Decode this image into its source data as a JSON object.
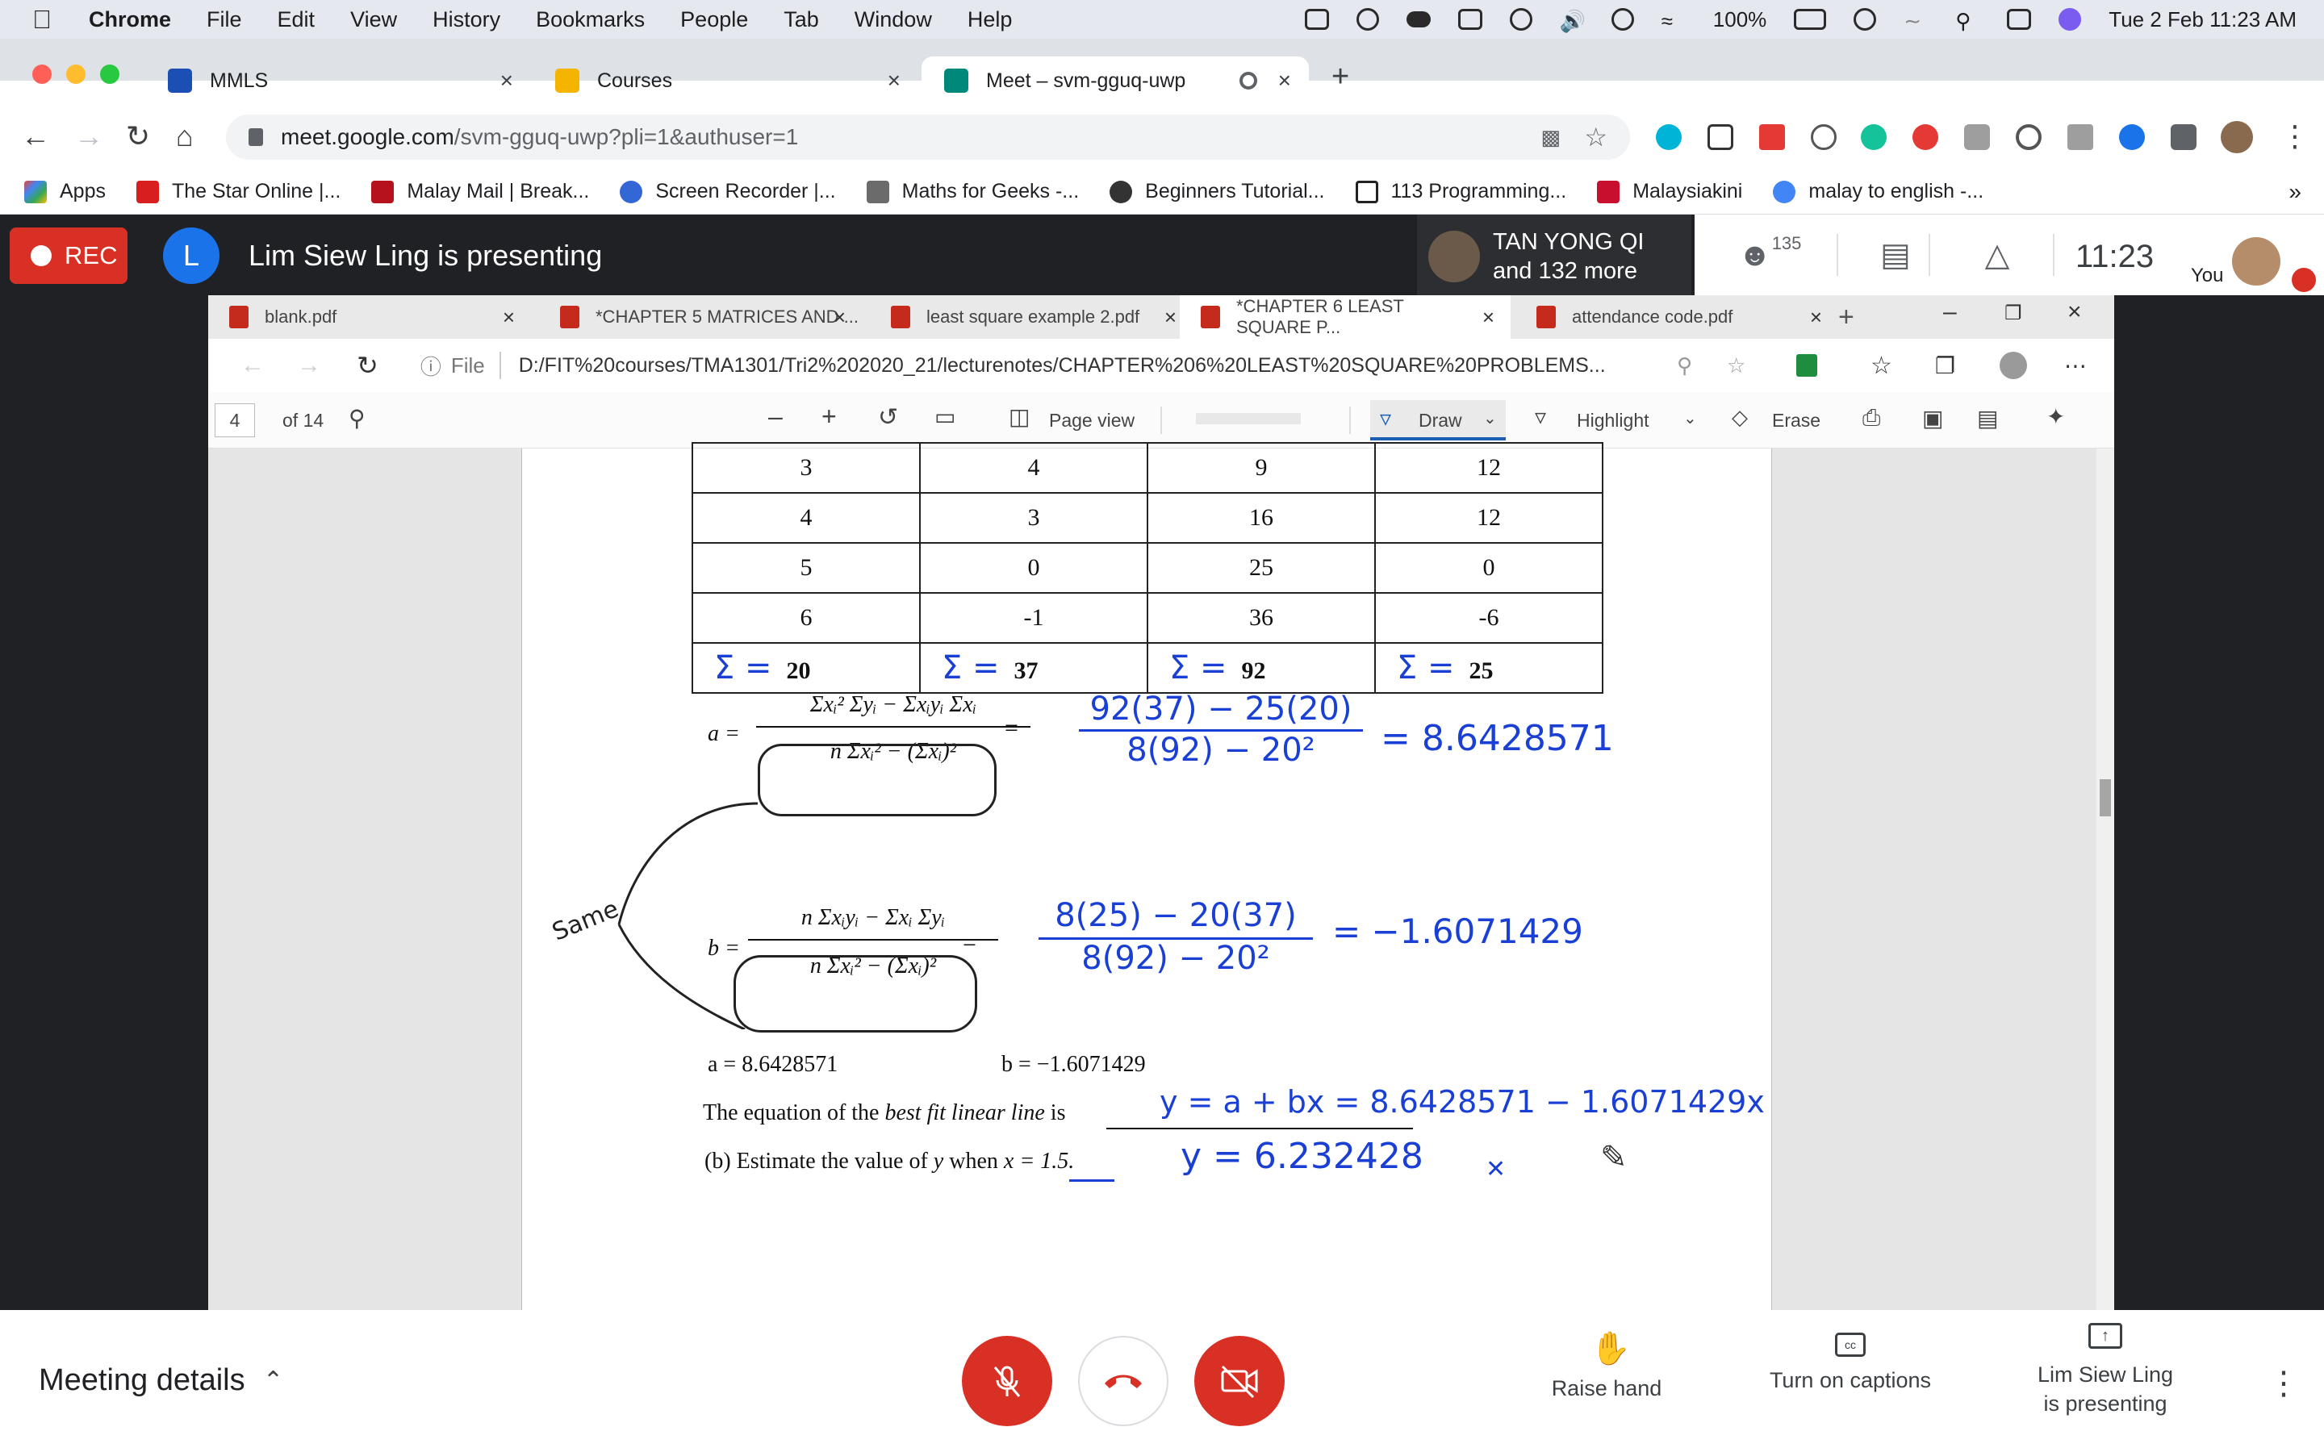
{
  "menubar": {
    "items": [
      "Chrome",
      "File",
      "Edit",
      "View",
      "History",
      "Bookmarks",
      "People",
      "Tab",
      "Window",
      "Help"
    ],
    "battery": "100%",
    "datetime": "Tue 2 Feb  11:23 AM"
  },
  "browser": {
    "tabs": [
      {
        "title": "MMLS",
        "color": "#1b4fb3"
      },
      {
        "title": "Courses",
        "color": "#f4b400"
      },
      {
        "title": "Meet – svm-gguq-uwp",
        "color": "#00897b"
      }
    ],
    "url_host": "meet.google.com",
    "url_path": "/svm-gguq-uwp?pli=1&authuser=1",
    "bookmarks": [
      {
        "label": "Apps",
        "color": "#ea4335"
      },
      {
        "label": "The Star Online |...",
        "color": "#d81e1e"
      },
      {
        "label": "Malay Mail | Break...",
        "color": "#b5121b"
      },
      {
        "label": "Screen Recorder |...",
        "color": "#3367d6"
      },
      {
        "label": "Maths for Geeks -...",
        "color": "#6b6b6b"
      },
      {
        "label": "Beginners Tutorial...",
        "color": "#333333"
      },
      {
        "label": "113 Programming...",
        "color": "#222222"
      },
      {
        "label": "Malaysiakini",
        "color": "#c8102e"
      },
      {
        "label": "malay to english -...",
        "color": "#4285f4"
      }
    ]
  },
  "meet": {
    "rec_label": "REC",
    "presenter_initial": "L",
    "presenting_text": "Lim Siew Ling is presenting",
    "participant_name": "TAN YONG QI",
    "participant_more": "and 132 more",
    "participant_count": "135",
    "time": "11:23",
    "self_label": "You",
    "meeting_details": "Meeting details",
    "raise_hand": "Raise hand",
    "captions": "Turn on captions",
    "presenting_line1": "Lim Siew Ling",
    "presenting_line2": "is presenting"
  },
  "shared": {
    "edge_tabs": [
      "blank.pdf",
      "*CHAPTER 5 MATRICES AND ...",
      "least square example 2.pdf",
      "*CHAPTER 6 LEAST SQUARE P...",
      "attendance code.pdf"
    ],
    "file_label": "File",
    "file_path": "D:/FIT%20courses/TMA1301/Tri2%202020_21/lecturenotes/CHAPTER%206%20LEAST%20SQUARE%20PROBLEMS...",
    "page_num": "4",
    "page_of": "of 14",
    "page_view": "Page view",
    "draw": "Draw",
    "highlight": "Highlight",
    "erase": "Erase",
    "table_rows": [
      [
        "3",
        "4",
        "9",
        "12"
      ],
      [
        "4",
        "3",
        "16",
        "12"
      ],
      [
        "5",
        "0",
        "25",
        "0"
      ],
      [
        "6",
        "-1",
        "36",
        "-6"
      ]
    ],
    "sums": [
      "20",
      "37",
      "92",
      "25"
    ],
    "sum_symbol": "Σ =",
    "formula_a_lhs": "a =",
    "formula_a_num": "Σxᵢ² Σyᵢ − Σxᵢyᵢ Σxᵢ",
    "formula_a_den": "n Σxᵢ² − (Σxᵢ)²",
    "formula_b_lhs": "b =",
    "formula_b_num": "n Σxᵢyᵢ − Σxᵢ Σyᵢ",
    "formula_b_den": "n Σxᵢ² − (Σxᵢ)²",
    "ink_a_num": "92(37) − 25(20)",
    "ink_a_den": "8(92) − 20²",
    "ink_a_result": "= 8.6428571",
    "ink_b_num": "8(25) − 20(37)",
    "ink_b_den": "8(92) − 20²",
    "ink_b_result": "= −1.6071429",
    "ink_same": "Same",
    "a_value": "a = 8.6428571",
    "b_value": "b = −1.6071429",
    "equation_text_1": "The equation of the",
    "equation_text_2": "best fit linear line",
    "equation_text_3": "is",
    "ink_equation": "y = a + bx  =  8.6428571 − 1.6071429x",
    "part_b_1": "(b)  Estimate the value of",
    "part_b_2": "y",
    "part_b_3": "when",
    "part_b_4": "x = 1.5.",
    "ink_answer": "y = 6.232428",
    "ink_mark": "✕"
  }
}
